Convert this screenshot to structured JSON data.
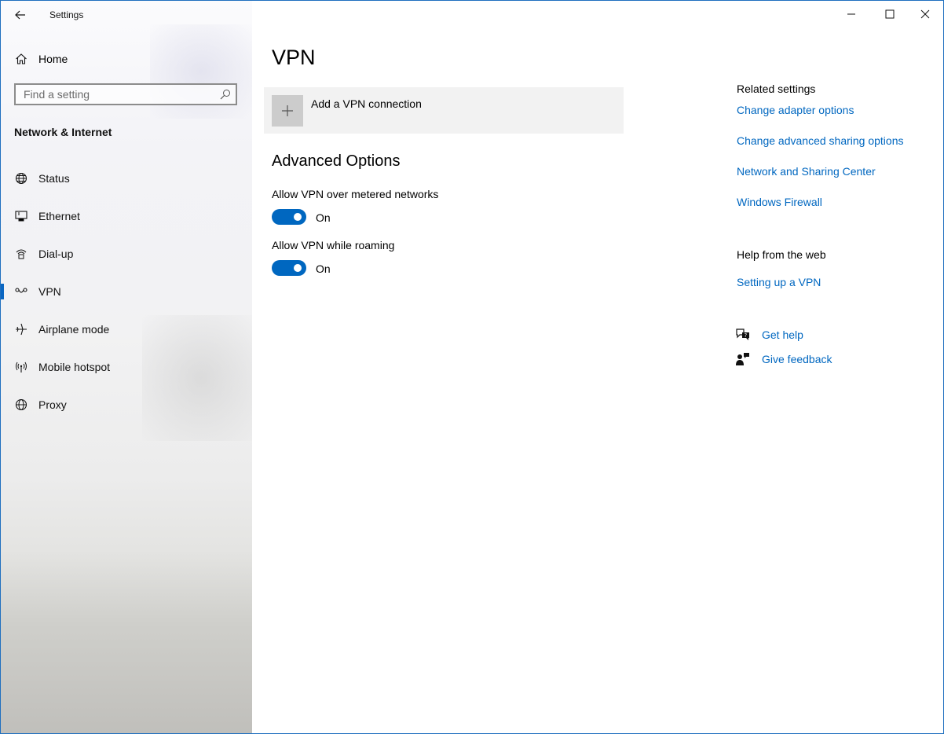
{
  "window": {
    "app_title": "Settings",
    "controls": {
      "minimize": "minimize",
      "maximize": "maximize",
      "close": "close"
    }
  },
  "sidebar": {
    "home_label": "Home",
    "search_placeholder": "Find a setting",
    "section_title": "Network & Internet",
    "items": [
      {
        "label": "Status",
        "icon": "globe-icon",
        "active": false
      },
      {
        "label": "Ethernet",
        "icon": "ethernet-icon",
        "active": false
      },
      {
        "label": "Dial-up",
        "icon": "dialup-icon",
        "active": false
      },
      {
        "label": "VPN",
        "icon": "vpn-icon",
        "active": true
      },
      {
        "label": "Airplane mode",
        "icon": "airplane-icon",
        "active": false
      },
      {
        "label": "Mobile hotspot",
        "icon": "hotspot-icon",
        "active": false
      },
      {
        "label": "Proxy",
        "icon": "globe-icon",
        "active": false
      }
    ]
  },
  "main": {
    "page_title": "VPN",
    "add_vpn_label": "Add a VPN connection",
    "advanced_title": "Advanced Options",
    "options": [
      {
        "label": "Allow VPN over metered networks",
        "state": "On",
        "on": true
      },
      {
        "label": "Allow VPN while roaming",
        "state": "On",
        "on": true
      }
    ]
  },
  "related": {
    "title": "Related settings",
    "links": [
      "Change adapter options",
      "Change advanced sharing options",
      "Network and Sharing Center",
      "Windows Firewall"
    ]
  },
  "web_help": {
    "title": "Help from the web",
    "links": [
      "Setting up a VPN"
    ]
  },
  "support": {
    "get_help": "Get help",
    "give_feedback": "Give feedback"
  },
  "colors": {
    "accent": "#0067c0",
    "link": "#0067c0",
    "active_indicator": "#0a66c2"
  }
}
